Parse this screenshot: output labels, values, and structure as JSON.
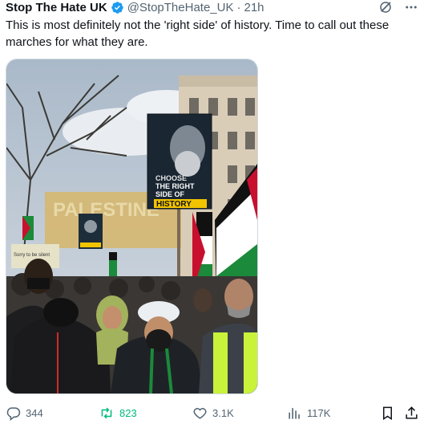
{
  "tweet": {
    "display_name": "Stop The Hate UK",
    "handle": "@StopTheHate_UK",
    "separator": "·",
    "time": "21h",
    "text": "This is most definitely not the 'right side' of history. Time to call out these marches for what they are."
  },
  "media": {
    "sign_line1": "CHOOSE",
    "sign_line2": "THE RIGHT",
    "sign_line3": "SIDE OF",
    "sign_line4": "HISTORY",
    "banner_text": "PALESTINE",
    "small_sign_text": "Sorry to be silent"
  },
  "actions": {
    "replies": "344",
    "retweets": "823",
    "likes": "3.1K",
    "views": "117K"
  },
  "colors": {
    "accent": "#1d9bf0",
    "retweet": "#00ba7c",
    "muted": "#536471"
  }
}
